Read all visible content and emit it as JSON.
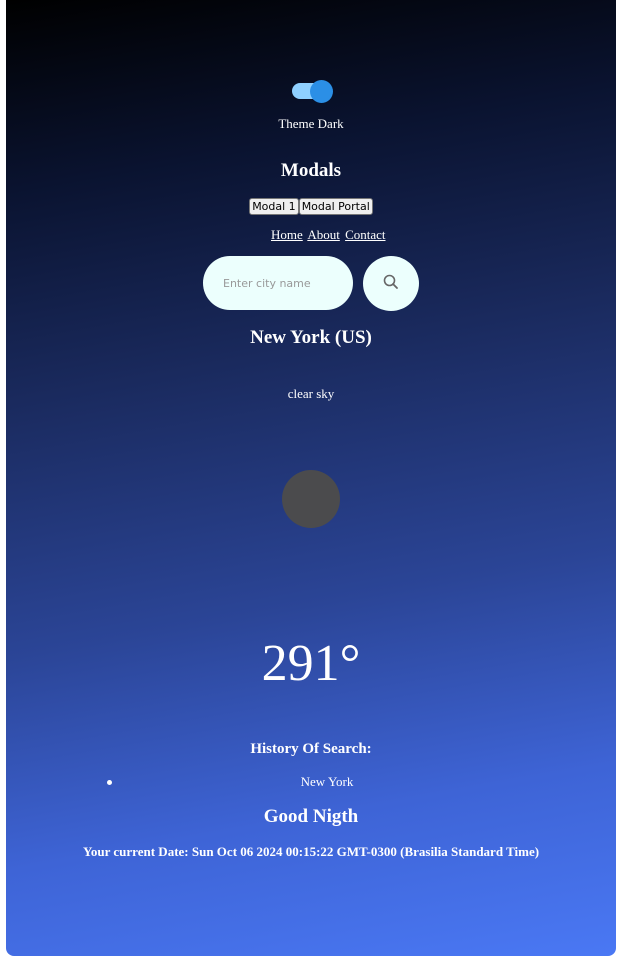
{
  "theme": {
    "label": "Theme Dark",
    "dark_mode_enabled": true
  },
  "modals": {
    "title": "Modals",
    "buttons": [
      "Modal 1",
      "Modal Portal"
    ]
  },
  "nav": {
    "links": [
      "Home",
      "About",
      "Contact"
    ]
  },
  "search": {
    "placeholder": "Enter city name",
    "value": "",
    "icon": "search-icon"
  },
  "weather": {
    "city": "New York (US)",
    "description": "clear sky",
    "icon": "weather-icon",
    "temperature": "291°"
  },
  "history": {
    "title": "History Of Search:",
    "items": [
      "New York"
    ]
  },
  "greeting": "Good Nigth",
  "current_date": "Your current Date: Sun Oct 06 2024 00:15:22 GMT-0300 (Brasilia Standard Time)",
  "colors": {
    "gradient_top": "#000000",
    "gradient_bottom": "#4a78f4",
    "toggle_track": "#8fd0ff",
    "toggle_knob": "#2b8fe6",
    "input_bg": "#ecfffd",
    "weather_icon_placeholder": "#4b4b4d"
  }
}
